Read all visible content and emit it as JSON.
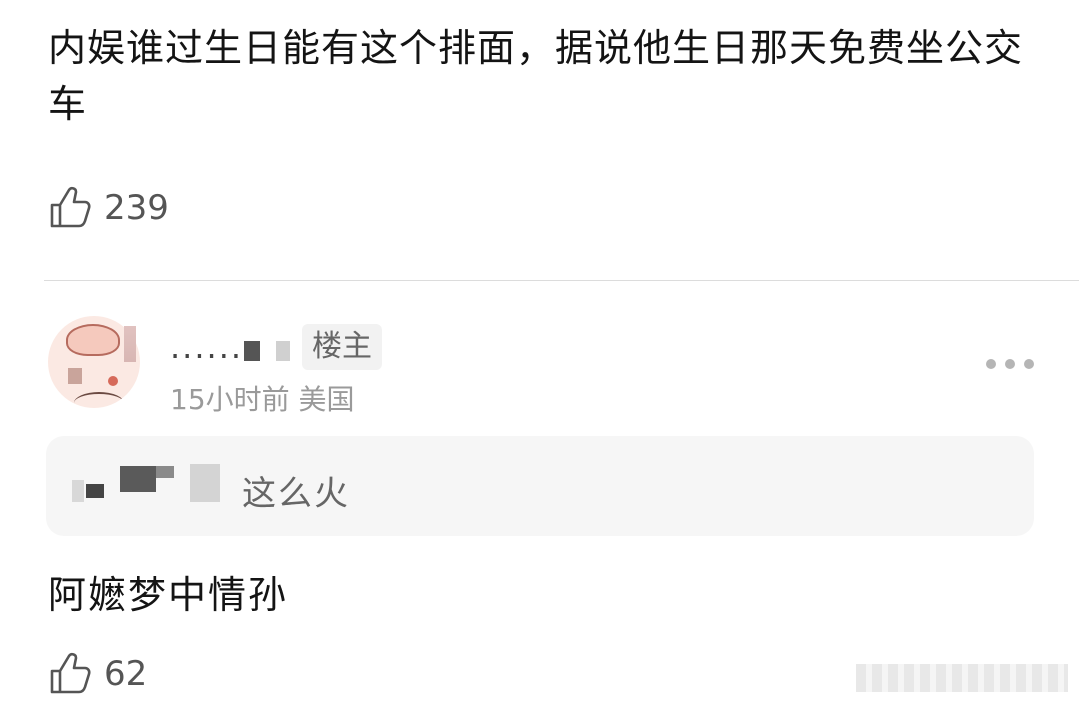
{
  "first_comment": {
    "text": "内娱谁过生日能有这个排面，据说他生日那天免费坐公交车",
    "likes": "239"
  },
  "reply": {
    "username": "......",
    "op_badge": "楼主",
    "meta": "15小时前 美国",
    "quote_text": "这么火",
    "text": "阿嬷梦中情孙",
    "likes": "62"
  }
}
